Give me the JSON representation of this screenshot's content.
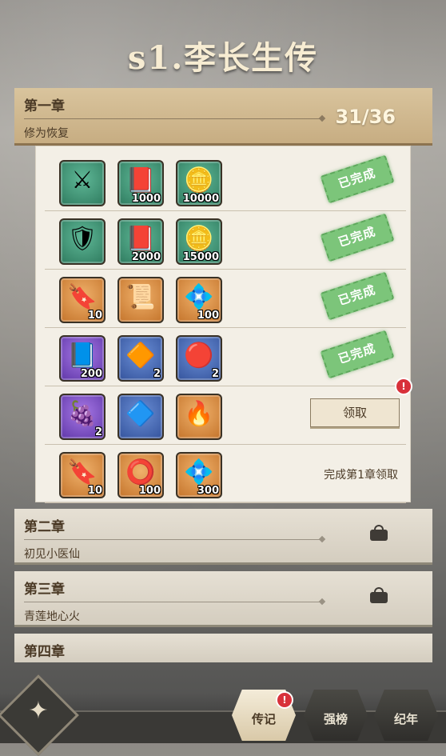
{
  "title": "s1.李长生传",
  "chapter1": {
    "title": "第一章",
    "subtitle": "修为恢复",
    "progress": "31/36",
    "rows": [
      {
        "items": [
          {
            "icon": "⚔",
            "quality": "green",
            "count": ""
          },
          {
            "icon": "📕",
            "quality": "green",
            "count": "1000"
          },
          {
            "icon": "🪙",
            "quality": "green",
            "count": "10000"
          }
        ],
        "status": "done",
        "label": "已完成"
      },
      {
        "items": [
          {
            "icon": "🛡",
            "quality": "green",
            "count": ""
          },
          {
            "icon": "📕",
            "quality": "green",
            "count": "2000"
          },
          {
            "icon": "🪙",
            "quality": "green",
            "count": "15000"
          }
        ],
        "status": "done",
        "label": "已完成"
      },
      {
        "items": [
          {
            "icon": "🔖",
            "quality": "orange",
            "count": "10"
          },
          {
            "icon": "📜",
            "quality": "orange",
            "count": ""
          },
          {
            "icon": "💠",
            "quality": "orange",
            "count": "100"
          }
        ],
        "status": "done",
        "label": "已完成"
      },
      {
        "items": [
          {
            "icon": "📘",
            "quality": "purple",
            "count": "200"
          },
          {
            "icon": "🔶",
            "quality": "blue",
            "count": "2"
          },
          {
            "icon": "🔴",
            "quality": "blue",
            "count": "2"
          }
        ],
        "status": "done",
        "label": "已完成"
      },
      {
        "items": [
          {
            "icon": "🍇",
            "quality": "purple",
            "count": "2"
          },
          {
            "icon": "🔷",
            "quality": "blue",
            "count": ""
          },
          {
            "icon": "🔥",
            "quality": "orange",
            "count": ""
          }
        ],
        "status": "claim",
        "label": "领取"
      },
      {
        "items": [
          {
            "icon": "🔖",
            "quality": "orange",
            "count": "10"
          },
          {
            "icon": "⭕",
            "quality": "orange",
            "count": "100"
          },
          {
            "icon": "💠",
            "quality": "orange",
            "count": "300"
          }
        ],
        "status": "locked",
        "label": "完成第1章领取"
      }
    ]
  },
  "chapters": [
    {
      "title": "第二章",
      "subtitle": "初见小医仙"
    },
    {
      "title": "第三章",
      "subtitle": "青莲地心火"
    },
    {
      "title": "第四章",
      "subtitle": ""
    }
  ],
  "nav": {
    "tabs": [
      {
        "label": "传记",
        "active": true,
        "badge": "!"
      },
      {
        "label": "强榜",
        "active": false
      },
      {
        "label": "纪年",
        "active": false
      }
    ]
  },
  "colors": {
    "accent": "#c7ad82",
    "done_stamp": "#7cc57a",
    "alert": "#d8313a"
  }
}
